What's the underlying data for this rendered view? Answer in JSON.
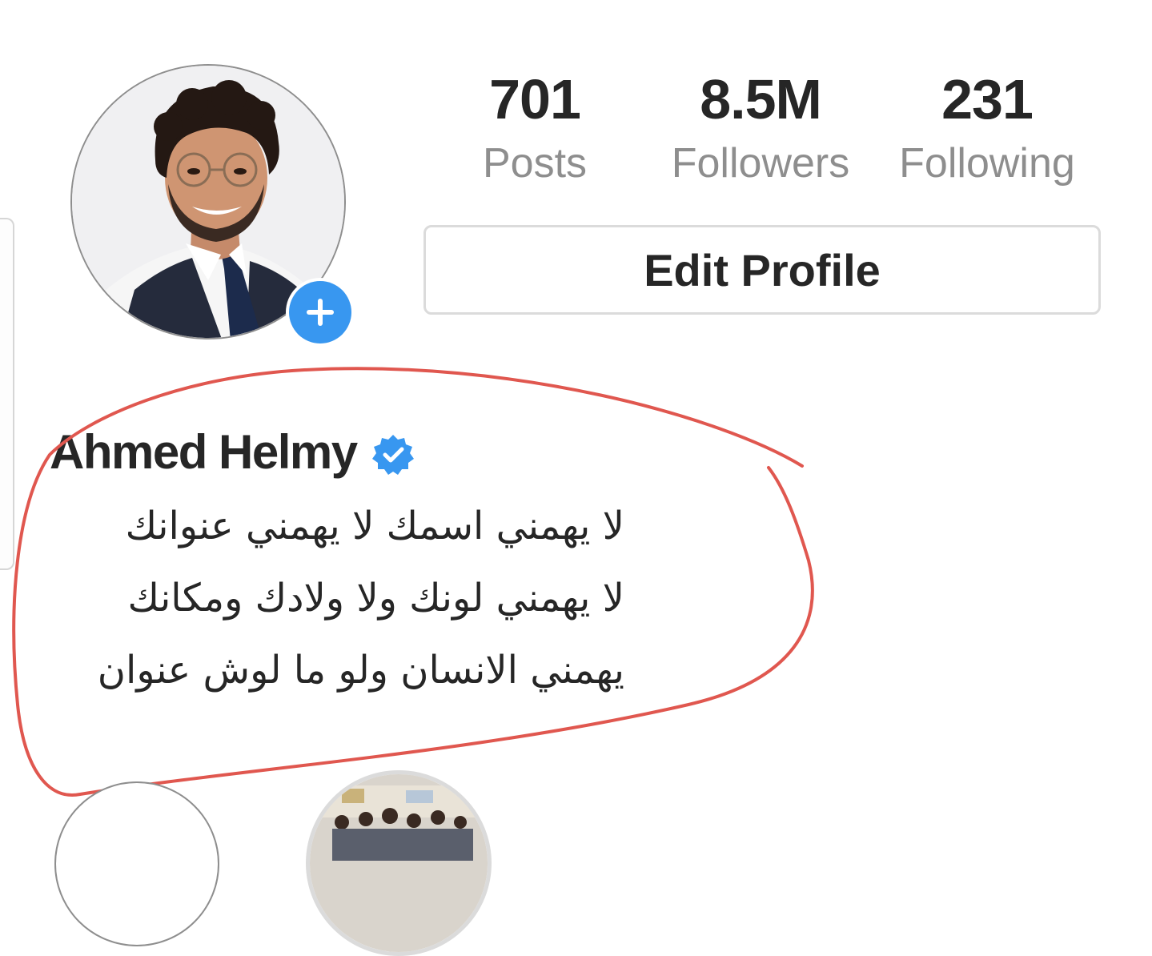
{
  "profile": {
    "avatar_alt": "Profile photo",
    "display_name": "Ahmed Helmy",
    "verified_icon": "verified-badge-icon",
    "add_story_icon": "plus-icon"
  },
  "stats": {
    "posts_value": "701",
    "posts_label": "Posts",
    "followers_value": "8.5M",
    "followers_label": "Followers",
    "following_value": "231",
    "following_label": "Following"
  },
  "actions": {
    "edit_profile_label": "Edit Profile"
  },
  "bio": {
    "lines": [
      "لا يهمني اسمك لا يهمني عنوانك",
      "لا يهمني لونك ولا ولادك ومكانك",
      "يهمني الانسان ولو ما لوش عنوان"
    ]
  },
  "colors": {
    "accent": "#3897f0",
    "text": "#262626",
    "muted": "#8e8e8e",
    "border": "#dbdbdb",
    "annotation": "#e0574f"
  }
}
